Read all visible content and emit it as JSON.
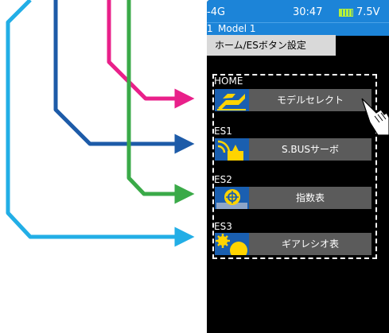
{
  "status": {
    "model_code": "-4G",
    "time": "30:47",
    "voltage": "7.5V"
  },
  "model": {
    "index": "1",
    "name": "Model 1"
  },
  "screen_title": "ホーム/ESボタン設定",
  "rows": [
    {
      "section": "HOME",
      "label": "モデルセレクト",
      "icon": "model-select-icon"
    },
    {
      "section": "ES1",
      "label": "S.BUSサーボ",
      "icon": "sbus-servo-icon"
    },
    {
      "section": "ES2",
      "label": "指数表",
      "icon": "index-table-icon"
    },
    {
      "section": "ES3",
      "label": "ギアレシオ表",
      "icon": "gear-ratio-icon"
    }
  ],
  "colors": {
    "status_bar": "#1c84d8",
    "arrow_home": "#e9208a",
    "arrow_es1": "#1d5ba8",
    "arrow_es2": "#3aaa48",
    "arrow_es3": "#22aee6"
  }
}
